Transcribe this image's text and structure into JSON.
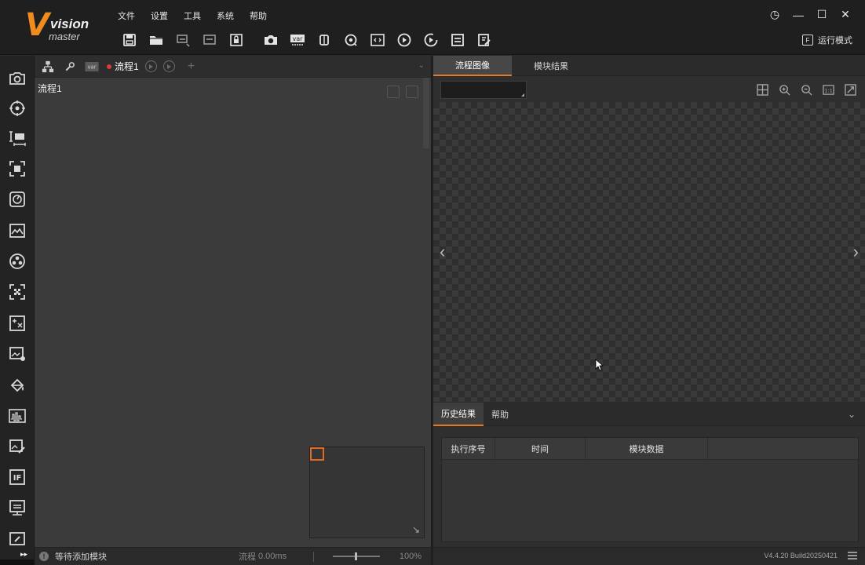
{
  "app": {
    "logo_letter": "V",
    "logo_word1": "vision",
    "logo_word2": "master",
    "menus": [
      "文件",
      "设置",
      "工具",
      "系统",
      "帮助"
    ],
    "run_mode": "运行模式"
  },
  "flow": {
    "active_tab": "流程1",
    "canvas_title": "流程1",
    "var_label": "var"
  },
  "image_panel": {
    "tabs": [
      "流程图像",
      "模块结果"
    ],
    "active_tab": "流程图像"
  },
  "history_panel": {
    "tabs": [
      "历史结果",
      "帮助"
    ],
    "active_tab": "历史结果",
    "columns": [
      "执行序号",
      "时间",
      "模块数据"
    ],
    "rows": []
  },
  "status": {
    "message": "等待添加模块",
    "flow_label": "流程",
    "time": "0.00ms",
    "zoom": "100%",
    "version": "V4.4.20 Build20250421"
  },
  "colors": {
    "accent": "#e07a2a",
    "brand_orange": "#f08c1e",
    "running_dot": "#e23a3a"
  }
}
